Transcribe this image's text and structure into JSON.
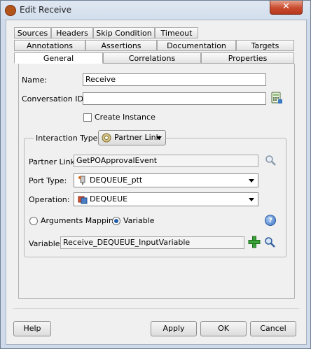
{
  "window": {
    "title": "Edit Receive",
    "close_symbol": "✕"
  },
  "tabs": {
    "row1": [
      {
        "label": "Sources"
      },
      {
        "label": "Headers"
      },
      {
        "label": "Skip Condition"
      },
      {
        "label": "Timeout"
      }
    ],
    "row2": [
      {
        "label": "Annotations"
      },
      {
        "label": "Assertions"
      },
      {
        "label": "Documentation"
      },
      {
        "label": "Targets"
      }
    ],
    "row3": [
      {
        "label": "General",
        "active": true
      },
      {
        "label": "Correlations"
      },
      {
        "label": "Properties"
      }
    ]
  },
  "form": {
    "name_label": "Name:",
    "name_value": "Receive",
    "conversation_label": "Conversation ID:",
    "conversation_value": "",
    "create_instance_label": "Create Instance",
    "create_instance_checked": false,
    "interaction_label": "Interaction Type:",
    "interaction_value": "Partner Link",
    "partner_link_label": "Partner Link:",
    "partner_link_value": "GetPOApprovalEvent",
    "port_type_label": "Port Type:",
    "port_type_value": "DEQUEUE_ptt",
    "operation_label": "Operation:",
    "operation_value": "DEQUEUE",
    "arguments_mapping_label": "Arguments Mapping",
    "variable_radio_label": "Variable",
    "selected_mode": "Variable",
    "variable_label": "Variable:",
    "variable_value": "Receive_DEQUEUE_InputVariable",
    "help_symbol": "?"
  },
  "buttons": {
    "help": "Help",
    "apply": "Apply",
    "ok": "OK",
    "cancel": "Cancel"
  },
  "icons": {
    "title": "jdeveloper-app-icon",
    "conversation": "calculator-icon",
    "interaction": "partner-link-icon",
    "partner_search": "search-icon",
    "port_type": "port-type-icon",
    "operation": "operation-icon",
    "help": "help-icon",
    "add_variable": "add-variable-icon",
    "variable_search": "search-icon"
  }
}
